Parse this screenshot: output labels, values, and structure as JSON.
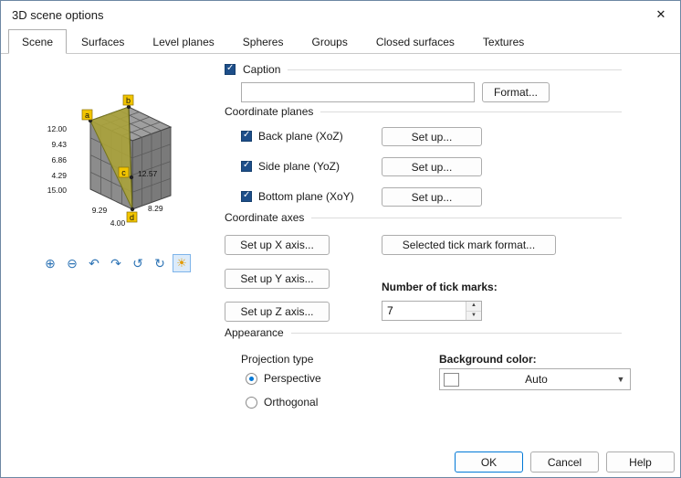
{
  "window": {
    "title": "3D scene options",
    "close_glyph": "✕"
  },
  "tabs": {
    "items": [
      "Scene",
      "Surfaces",
      "Level planes",
      "Spheres",
      "Groups",
      "Closed surfaces",
      "Textures"
    ],
    "active": "Scene"
  },
  "preview": {
    "point_labels": [
      "a",
      "b",
      "c",
      "d"
    ],
    "z_ticks": [
      "12.00",
      "9.43",
      "6.86",
      "4.29"
    ],
    "corner_tick": "15.00",
    "bottom_tick": "9.29",
    "apex_tick": "4.00",
    "right_ticks": [
      "12.57",
      "8.29"
    ],
    "toolbar": [
      {
        "name": "zoom-in-icon",
        "glyph": "⊕"
      },
      {
        "name": "zoom-out-icon",
        "glyph": "⊖"
      },
      {
        "name": "rotate-left-icon",
        "glyph": "↶"
      },
      {
        "name": "rotate-right-icon",
        "glyph": "↷"
      },
      {
        "name": "rotate-up-icon",
        "glyph": "↺"
      },
      {
        "name": "rotate-down-icon",
        "glyph": "↻"
      },
      {
        "name": "light-icon",
        "glyph": "☀",
        "selected": true
      }
    ]
  },
  "caption": {
    "label": "Caption",
    "checked": true,
    "value": "",
    "format_button": "Format..."
  },
  "coordinate_planes": {
    "heading": "Coordinate planes",
    "items": [
      {
        "label": "Back plane (XoZ)",
        "checked": true,
        "button": "Set up..."
      },
      {
        "label": "Side plane (YoZ)",
        "checked": true,
        "button": "Set up..."
      },
      {
        "label": "Bottom plane (XoY)",
        "checked": true,
        "button": "Set up..."
      }
    ]
  },
  "coordinate_axes": {
    "heading": "Coordinate axes",
    "x_button": "Set up X axis...",
    "y_button": "Set up Y axis...",
    "z_button": "Set up Z axis...",
    "tick_format_button": "Selected tick mark format...",
    "tick_count_label": "Number of tick marks:",
    "tick_count_value": "7"
  },
  "appearance": {
    "heading": "Appearance",
    "projection_group": "Projection type",
    "options": [
      {
        "label": "Perspective",
        "selected": true
      },
      {
        "label": "Orthogonal",
        "selected": false
      }
    ],
    "background_label": "Background color:",
    "background_value": "Auto",
    "background_swatch": "#ffffff"
  },
  "footer": {
    "ok": "OK",
    "cancel": "Cancel",
    "help": "Help"
  },
  "colors": {
    "accent": "#0078d7",
    "checkbox": "#1d4e89",
    "surface_yellow": "#aaa23a"
  }
}
